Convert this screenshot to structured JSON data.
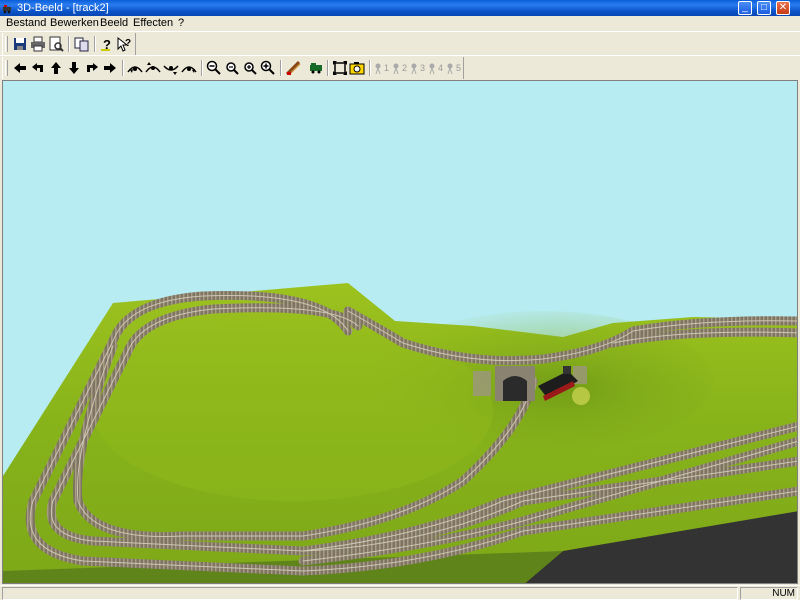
{
  "window": {
    "title": "3D-Beeld - [track2]"
  },
  "titlebar_buttons": {
    "minimize": "_",
    "maximize": "□",
    "close": "✕"
  },
  "menu": [
    "Bestand",
    "Bewerken",
    "Beeld",
    "Effecten",
    "?"
  ],
  "toolbar1": [
    "save-icon",
    "print-icon",
    "print-preview-icon",
    "copy-icon",
    "help-icon",
    "context-help-icon"
  ],
  "toolbar2": {
    "navigation": [
      "arrow-left-icon",
      "rotate-left-icon",
      "arrow-up-icon",
      "arrow-down-icon",
      "rotate-right-icon",
      "arrow-right-icon"
    ],
    "camera_tilt": [
      "tilt-icon-1",
      "tilt-icon-2",
      "tilt-icon-3",
      "tilt-icon-4"
    ],
    "zoom": [
      "zoom-out-icon",
      "zoom-out-small-icon",
      "zoom-in-icon",
      "zoom-in-large-icon"
    ],
    "effects": [
      "track-tool-icon",
      "train-icon",
      "fit-view-icon",
      "camera-snapshot-icon"
    ],
    "cameras": [
      "1",
      "2",
      "3",
      "4",
      "5"
    ]
  },
  "status": {
    "num": "NUM"
  },
  "colors": {
    "sky": "#b7ecf2",
    "grass": "#8fba1c",
    "grass_shade": "#6f9a18",
    "track_bed": "#7a705e",
    "rail": "#c9c0b0"
  }
}
